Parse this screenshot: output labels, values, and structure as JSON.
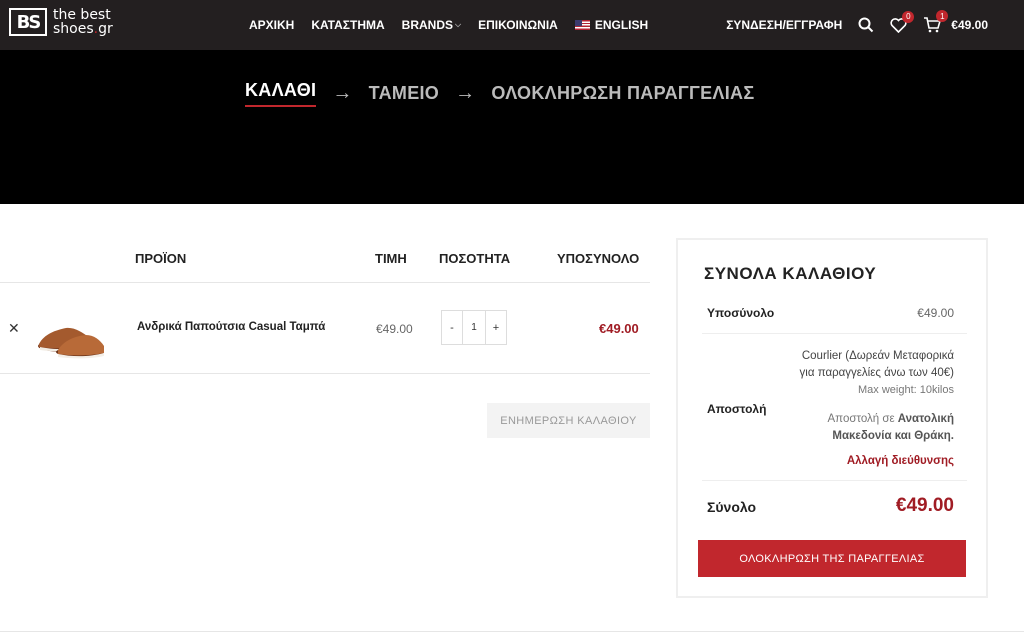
{
  "header": {
    "logo_mark": "BS",
    "logo_line1": "the best",
    "logo_line2_a": "shoes",
    "logo_dot": ".",
    "logo_line2_b": "gr",
    "nav": [
      "ΑΡΧΙΚΗ",
      "ΚΑΤΑΣΤΗΜΑ",
      "BRANDS",
      "ΕΠΙΚΟΙΝΩΝΙΑ",
      "ENGLISH"
    ],
    "login": "ΣΥΝΔΕΣΗ/ΕΓΓΡΑΦΗ",
    "wishlist_count": "0",
    "cart_count": "1",
    "cart_total": "€49.00"
  },
  "steps": {
    "cart": "ΚΑΛΑΘΙ",
    "checkout": "ΤΑΜΕΙΟ",
    "complete": "ΟΛΟΚΛΗΡΩΣΗ ΠΑΡΑΓΓΕΛΙΑΣ",
    "arrow": "→"
  },
  "table": {
    "headers": {
      "product": "ΠΡΟΪΟΝ",
      "price": "ΤΙΜΗ",
      "quantity": "ΠΟΣΟΤΗΤΑ",
      "subtotal": "ΥΠΟΣΥΝΟΛΟ"
    },
    "item": {
      "remove": "✕",
      "name": "Ανδρικά Παπούτσια Casual Ταμπά",
      "price": "€49.00",
      "qty_minus": "-",
      "qty": "1",
      "qty_plus": "+",
      "subtotal": "€49.00"
    },
    "update_button": "ΕΝΗΜΕΡΩΣΗ ΚΑΛΑΘΙΟΥ"
  },
  "totals": {
    "title": "ΣΥΝΟΛΑ ΚΑΛΑΘΙΟΥ",
    "subtotal_label": "Υποσύνολο",
    "subtotal_value": "€49.00",
    "shipping_label": "Αποστολή",
    "shipping_method_1": "Courlier (Δωρεάν Μεταφορικά",
    "shipping_method_2": "για παραγγελίες άνω των 40€)",
    "shipping_weight": "Max weight: 10kilos",
    "shipping_dest_prefix": "Αποστολή σε ",
    "shipping_dest_region_1": "Ανατολική",
    "shipping_dest_region_2": "Μακεδονία και Θράκη.",
    "change_address": "Αλλαγή διεύθυνσης",
    "total_label": "Σύνολο",
    "total_value": "€49.00",
    "checkout_button": "ΟΛΟΚΛΗΡΩΣΗ ΤΗΣ ΠΑΡΑΓΓΕΛΙΑΣ"
  },
  "colors": {
    "accent": "#c1272d",
    "price_red": "#a01c24",
    "header_bg": "#231f20"
  }
}
